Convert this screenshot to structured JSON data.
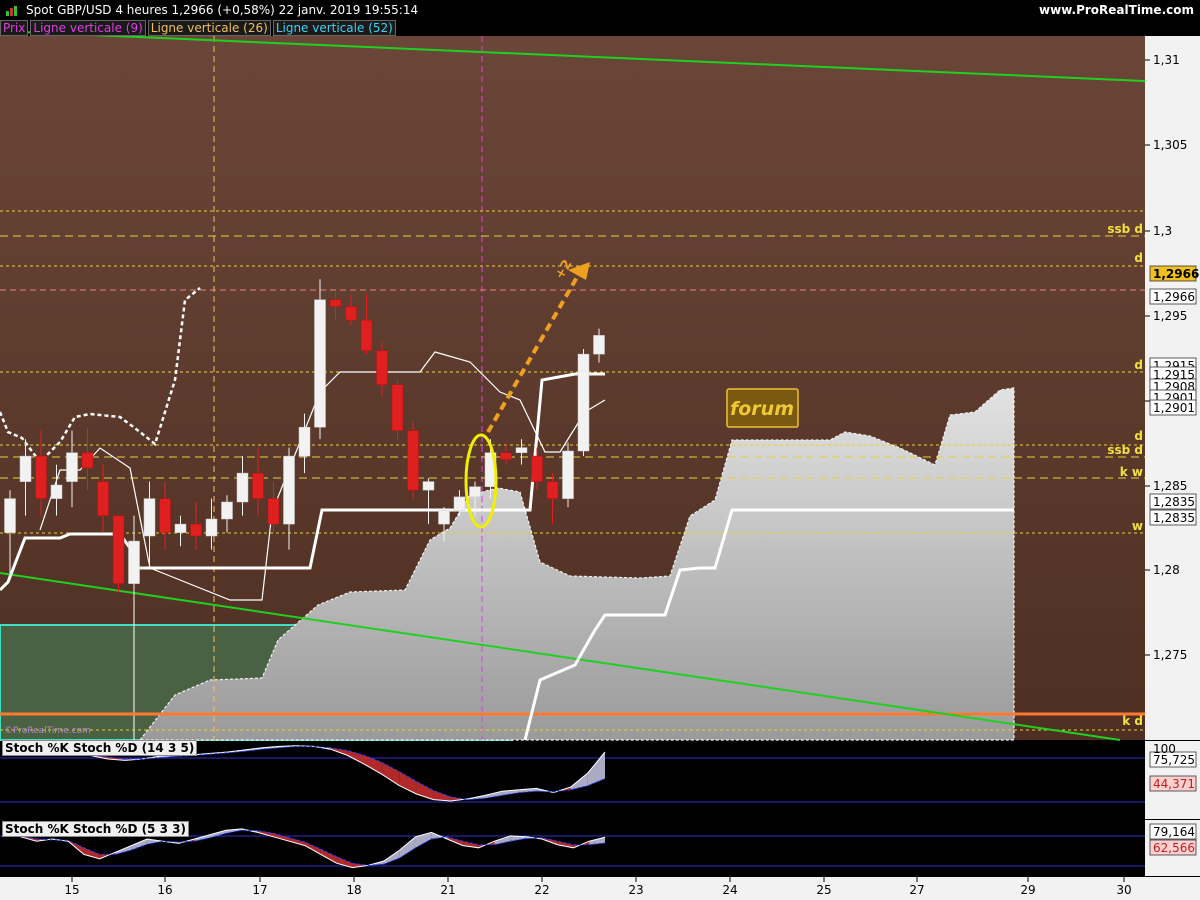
{
  "header": {
    "title": "Spot GBP/USD   4 heures   1,2966 (+0,58%)   22 janv. 2019 19:55:14",
    "site": "www.ProRealTime.com"
  },
  "legend": [
    {
      "label": "Prix",
      "color": "#e040e0"
    },
    {
      "label": "Ligne verticale (9)",
      "color": "#e040e0"
    },
    {
      "label": "Ligne verticale (26)",
      "color": "#f0c060"
    },
    {
      "label": "Ligne verticale (52)",
      "color": "#40d0f0"
    }
  ],
  "watermark": "©ProRealTime.com",
  "chart_data": [
    {
      "type": "candlestick",
      "title": "Spot GBP/USD 4 heures",
      "ylim": [
        1.2706,
        1.3128
      ],
      "y_ticks": [
        "1,31",
        "1,305",
        "1,3",
        "1,295",
        "1,29",
        "1,285",
        "1,28",
        "1,275"
      ],
      "x_ticks": [
        "15",
        "16",
        "17",
        "18",
        "21",
        "22",
        "23",
        "24",
        "25",
        "27",
        "29",
        "30"
      ],
      "candles": [
        {
          "o": 1.285,
          "h": 1.2875,
          "l": 1.2825,
          "c": 1.287
        },
        {
          "o": 1.288,
          "h": 1.2905,
          "l": 1.286,
          "c": 1.2895
        },
        {
          "o": 1.2895,
          "h": 1.291,
          "l": 1.286,
          "c": 1.287
        },
        {
          "o": 1.287,
          "h": 1.289,
          "l": 1.286,
          "c": 1.2878
        },
        {
          "o": 1.288,
          "h": 1.291,
          "l": 1.2865,
          "c": 1.2897
        },
        {
          "o": 1.2897,
          "h": 1.2912,
          "l": 1.2875,
          "c": 1.2888
        },
        {
          "o": 1.288,
          "h": 1.289,
          "l": 1.285,
          "c": 1.286
        },
        {
          "o": 1.286,
          "h": 1.286,
          "l": 1.2815,
          "c": 1.282
        },
        {
          "o": 1.282,
          "h": 1.286,
          "l": 1.2812,
          "c": 1.2845
        },
        {
          "o": 1.2848,
          "h": 1.288,
          "l": 1.283,
          "c": 1.287
        },
        {
          "o": 1.287,
          "h": 1.288,
          "l": 1.284,
          "c": 1.285
        },
        {
          "o": 1.285,
          "h": 1.286,
          "l": 1.2842,
          "c": 1.2855
        },
        {
          "o": 1.2855,
          "h": 1.2868,
          "l": 1.284,
          "c": 1.2848
        },
        {
          "o": 1.2848,
          "h": 1.287,
          "l": 1.284,
          "c": 1.2858
        },
        {
          "o": 1.2858,
          "h": 1.2872,
          "l": 1.285,
          "c": 1.2868
        },
        {
          "o": 1.2868,
          "h": 1.2895,
          "l": 1.286,
          "c": 1.2885
        },
        {
          "o": 1.2885,
          "h": 1.29,
          "l": 1.286,
          "c": 1.287
        },
        {
          "o": 1.287,
          "h": 1.288,
          "l": 1.285,
          "c": 1.2855
        },
        {
          "o": 1.2855,
          "h": 1.29,
          "l": 1.284,
          "c": 1.2895
        },
        {
          "o": 1.2895,
          "h": 1.292,
          "l": 1.2885,
          "c": 1.2912
        },
        {
          "o": 1.2912,
          "h": 1.2999,
          "l": 1.2905,
          "c": 1.2987
        },
        {
          "o": 1.2987,
          "h": 1.2992,
          "l": 1.2975,
          "c": 1.2983
        },
        {
          "o": 1.2983,
          "h": 1.299,
          "l": 1.2972,
          "c": 1.2975
        },
        {
          "o": 1.2975,
          "h": 1.299,
          "l": 1.2955,
          "c": 1.2957
        },
        {
          "o": 1.2957,
          "h": 1.2962,
          "l": 1.293,
          "c": 1.2937
        },
        {
          "o": 1.2937,
          "h": 1.294,
          "l": 1.2905,
          "c": 1.291
        },
        {
          "o": 1.291,
          "h": 1.2915,
          "l": 1.287,
          "c": 1.2875
        },
        {
          "o": 1.2875,
          "h": 1.2882,
          "l": 1.2855,
          "c": 1.288
        },
        {
          "o": 1.2855,
          "h": 1.2865,
          "l": 1.2845,
          "c": 1.2863
        },
        {
          "o": 1.2863,
          "h": 1.2875,
          "l": 1.286,
          "c": 1.2871
        },
        {
          "o": 1.2871,
          "h": 1.288,
          "l": 1.286,
          "c": 1.2877
        },
        {
          "o": 1.2877,
          "h": 1.2905,
          "l": 1.287,
          "c": 1.2897
        },
        {
          "o": 1.2897,
          "h": 1.2902,
          "l": 1.289,
          "c": 1.2893
        },
        {
          "o": 1.2897,
          "h": 1.2905,
          "l": 1.289,
          "c": 1.29
        },
        {
          "o": 1.2895,
          "h": 1.29,
          "l": 1.2875,
          "c": 1.288
        },
        {
          "o": 1.288,
          "h": 1.2885,
          "l": 1.2855,
          "c": 1.287
        },
        {
          "o": 1.287,
          "h": 1.2903,
          "l": 1.2865,
          "c": 1.2898
        },
        {
          "o": 1.2898,
          "h": 1.2958,
          "l": 1.2895,
          "c": 1.2955
        },
        {
          "o": 1.2955,
          "h": 1.297,
          "l": 1.295,
          "c": 1.2966
        }
      ],
      "price_labels": [
        "1,2966",
        "1,2966",
        "1,2915",
        "1,2915",
        "1,2908",
        "1,2901",
        "1,2901",
        "1,2835",
        "1,2835"
      ],
      "level_labels": [
        "ssb d",
        "d",
        "d",
        "d",
        "ssb d",
        "k w",
        "w",
        "k d"
      ],
      "annotation": "forum",
      "arrow_label": "+2"
    },
    {
      "type": "line",
      "title": "Stoch %K  Stoch %D (14 3 5)",
      "ylim": [
        0,
        100
      ],
      "y_ticks": [
        "100"
      ],
      "value_labels": [
        "75,725",
        "44,371"
      ],
      "series": [
        {
          "name": "Stoch %K",
          "values": [
            95,
            93,
            90,
            88,
            86,
            85,
            80,
            78,
            80,
            84,
            85,
            86,
            88,
            90,
            93,
            96,
            98,
            99,
            98,
            94,
            85,
            72,
            58,
            42,
            30,
            22,
            20,
            23,
            28,
            34,
            36,
            38,
            32,
            40,
            60,
            90
          ]
        },
        {
          "name": "Stoch %D",
          "values": [
            95,
            94,
            92,
            89,
            87,
            86,
            83,
            80,
            80,
            82,
            84,
            85,
            87,
            89,
            91,
            94,
            96,
            98,
            98,
            96,
            92,
            85,
            75,
            62,
            48,
            35,
            26,
            22,
            24,
            28,
            32,
            34,
            33,
            36,
            42,
            52
          ]
        }
      ]
    },
    {
      "type": "line",
      "title": "Stoch %K  Stoch %D (5 3 3)",
      "ylim": [
        0,
        100
      ],
      "value_labels": [
        "79,164",
        "62,566"
      ],
      "series": [
        {
          "name": "Stoch %K",
          "values": [
            88,
            80,
            70,
            75,
            70,
            40,
            30,
            45,
            60,
            75,
            70,
            65,
            75,
            85,
            95,
            98,
            90,
            80,
            70,
            60,
            40,
            20,
            10,
            15,
            25,
            50,
            80,
            90,
            75,
            60,
            55,
            70,
            82,
            80,
            75,
            62,
            55,
            70,
            79
          ]
        },
        {
          "name": "Stoch %D",
          "values": [
            85,
            82,
            75,
            73,
            72,
            55,
            40,
            40,
            50,
            63,
            70,
            68,
            70,
            78,
            88,
            95,
            94,
            88,
            78,
            68,
            52,
            35,
            20,
            15,
            18,
            32,
            55,
            75,
            80,
            70,
            62,
            62,
            70,
            76,
            78,
            70,
            62,
            62,
            66
          ]
        }
      ]
    }
  ]
}
